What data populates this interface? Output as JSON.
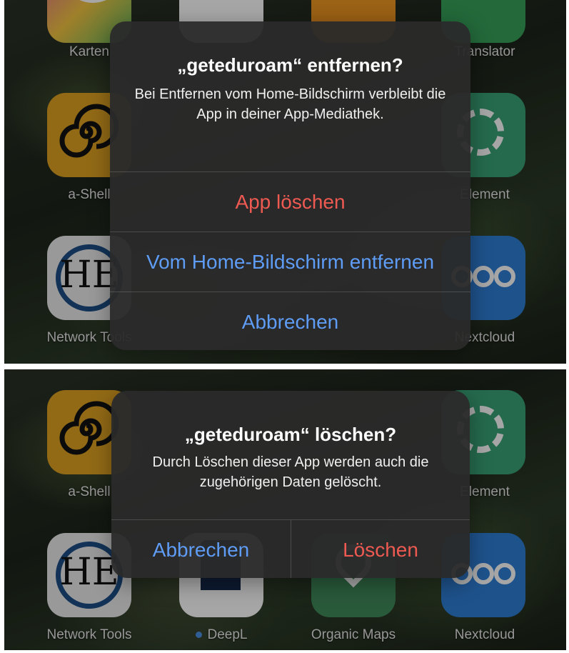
{
  "top": {
    "apps": {
      "karten": "Karten",
      "translator": "Translator",
      "ashell": "a-Shell",
      "element": "Element",
      "network_tools": "Network Tools",
      "nextcloud": "Nextcloud"
    },
    "dialog": {
      "title": "„geteduroam“ entfernen?",
      "message": "Bei Entfernen vom Home-Bildschirm verbleibt die App in deiner App-Mediathek.",
      "delete_app_label": "App löschen",
      "remove_from_home_label": "Vom Home-Bildschirm entfernen",
      "cancel_label": "Abbrechen"
    }
  },
  "bottom": {
    "apps": {
      "ashell": "a-Shell",
      "element": "Element",
      "network_tools": "Network Tools",
      "deepl": "DeepL",
      "organic_maps": "Organic Maps",
      "nextcloud": "Nextcloud"
    },
    "dialog": {
      "title": "„geteduroam“ löschen?",
      "message": "Durch Löschen dieser App werden auch die zugehörigen Daten gelöscht.",
      "cancel_label": "Abbrechen",
      "delete_label": "Löschen"
    }
  },
  "colors": {
    "destructive": "#ee5a52",
    "accent": "#5e9cf5",
    "alert_background": "#2a2a2a"
  },
  "icons": {
    "karten": "map-star-icon",
    "shortcuts": "shortcuts-icon",
    "game": "board-game-icon",
    "translator": "translator-icon",
    "ashell": "spiral-shell-icon",
    "element": "element-ring-icon",
    "network_tools": "he-network-tools-icon",
    "nextcloud": "nextcloud-icon",
    "deepl": "deepl-icon",
    "organic_maps": "organic-maps-icon",
    "new_app_dot": "blue-dot-icon"
  }
}
